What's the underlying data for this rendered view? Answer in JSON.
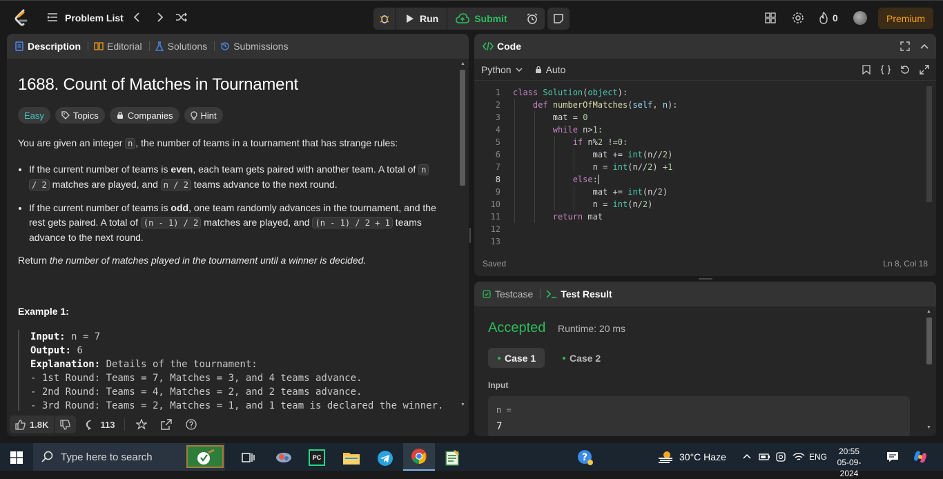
{
  "topbar": {
    "problem_list": "Problem List",
    "run": "Run",
    "submit": "Submit",
    "streak": "0",
    "premium": "Premium",
    "colors": {
      "premium": "#ffa116",
      "submit": "#2cbb5d"
    }
  },
  "desc_tabs": [
    "Description",
    "Editorial",
    "Solutions",
    "Submissions"
  ],
  "problem": {
    "title": "1688. Count of Matches in Tournament",
    "difficulty": "Easy",
    "chips": [
      "Topics",
      "Companies",
      "Hint"
    ],
    "intro_pre": "You are given an integer ",
    "intro_code": "n",
    "intro_post": ", the number of teams in a tournament that has strange rules:",
    "rule1": {
      "a": "If the current number of teams is ",
      "b": "even",
      "c": ", each team gets paired with another team. A total of ",
      "code1": "n",
      "code2": "/ 2",
      "d": " matches are played, and ",
      "code3": "n / 2",
      "e": " teams advance to the next round."
    },
    "rule2": {
      "a": "If the current number of teams is ",
      "b": "odd",
      "c": ", one team randomly advances in the tournament, and the rest gets paired. A total of ",
      "code1": "(n - 1) / 2",
      "d": " matches are played, and ",
      "code2": "(n - 1) / 2 + 1",
      "e": " teams advance to the next round."
    },
    "return_pre": "Return ",
    "return_em": "the number of matches played in the tournament until a winner is decided.",
    "example_title": "Example 1:",
    "example": {
      "input_label": "Input:",
      "input_value": " n = 7",
      "output_label": "Output:",
      "output_value": " 6",
      "explanation_label": "Explanation:",
      "explanation_value": " Details of the tournament:",
      "lines": [
        "- 1st Round: Teams = 7, Matches = 3, and 4 teams advance.",
        "- 2nd Round: Teams = 4, Matches = 2, and 2 teams advance.",
        "- 3rd Round: Teams = 2, Matches = 1, and 1 team is declared the winner."
      ]
    }
  },
  "desc_footer": {
    "likes": "1.8K",
    "comments": "113"
  },
  "code_panel": {
    "title": "Code",
    "language": "Python",
    "mode": "Auto",
    "status": "Saved",
    "cursor": "Ln 8, Col 18"
  },
  "code_lines": [
    "class Solution(object):",
    "    def numberOfMatches(self, n):",
    "        mat = 0",
    "        while n>1:",
    "            if n%2 !=0:",
    "                mat += int(n//2)",
    "                n = int(n//2) +1",
    "            else:",
    "                mat += int(n/2)",
    "                n = int(n/2)",
    "        return mat",
    "",
    ""
  ],
  "result_panel": {
    "tabs": [
      "Testcase",
      "Test Result"
    ],
    "verdict": "Accepted",
    "runtime": "Runtime: 20 ms",
    "cases": [
      "Case 1",
      "Case 2"
    ],
    "input_label": "Input",
    "var_label": "n =",
    "var_value": "7"
  },
  "taskbar": {
    "search_placeholder": "Type here to search",
    "weather": "30°C  Haze",
    "lang": "ENG",
    "time": "20:55",
    "date": "05-09-2024"
  }
}
